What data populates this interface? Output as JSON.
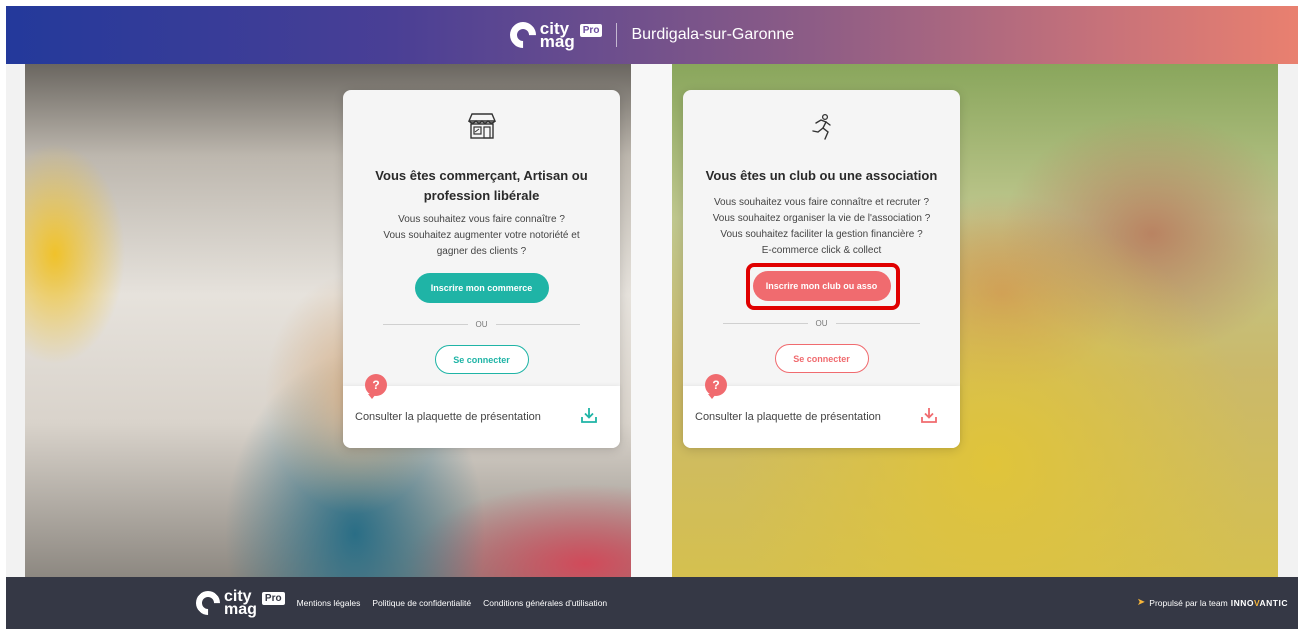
{
  "header": {
    "logo": {
      "line1": "city",
      "line2": "mag",
      "badge": "Pro"
    },
    "city": "Burdigala-sur-Garonne"
  },
  "cards": {
    "merchant": {
      "icon": "storefront-icon",
      "title": "Vous êtes commerçant, Artisan ou profession libérale",
      "desc_lines": [
        "Vous souhaitez vous faire connaître ?",
        "Vous souhaitez augmenter votre notoriété et",
        "gagner des clients ?"
      ],
      "primary_label": "Inscrire mon commerce",
      "or_label": "OU",
      "secondary_label": "Se connecter",
      "brochure_label": "Consulter la plaquette de présentation",
      "accent": "#1fb4a6"
    },
    "club": {
      "icon": "runner-icon",
      "title": "Vous êtes un club ou une association",
      "desc_lines": [
        "Vous souhaitez vous faire connaître et recruter ?",
        "Vous souhaitez organiser la vie de l'association ?",
        "Vous souhaitez faciliter la gestion financière ?",
        "E-commerce click & collect"
      ],
      "primary_label": "Inscrire mon club ou asso",
      "or_label": "OU",
      "secondary_label": "Se connecter",
      "brochure_label": "Consulter la plaquette de présentation",
      "accent": "#f06b6f"
    },
    "help_glyph": "?"
  },
  "footer": {
    "logo": {
      "line1": "city",
      "line2": "mag",
      "badge": "Pro"
    },
    "links": {
      "legal": "Mentions légales",
      "privacy": "Politique de confidentialité",
      "terms": "Conditions générales d'utilisation"
    },
    "powered_by": "Propulsé par la team",
    "company_pre": "INNO",
    "company_v": "V",
    "company_post": "ANTIC"
  }
}
